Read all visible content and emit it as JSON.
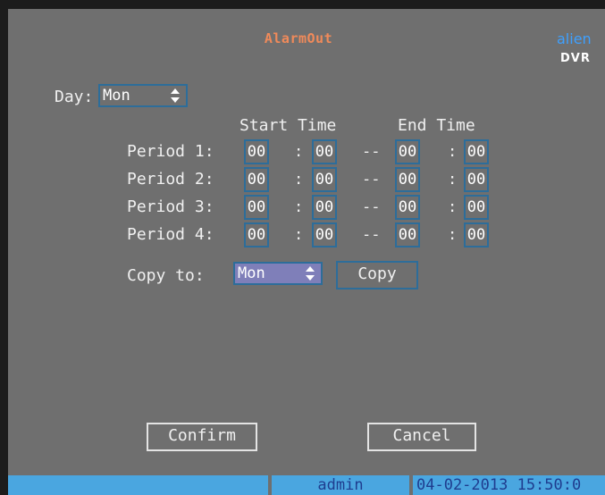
{
  "title": "AlarmOut",
  "logo": {
    "top": "alien",
    "bottom": "DVR"
  },
  "day": {
    "label": "Day:",
    "value": "Mon"
  },
  "headers": {
    "start": "Start Time",
    "end": "End Time"
  },
  "periods": [
    {
      "label": "Period 1:",
      "start_h": "00",
      "start_m": "00",
      "end_h": "00",
      "end_m": "00"
    },
    {
      "label": "Period 2:",
      "start_h": "00",
      "start_m": "00",
      "end_h": "00",
      "end_m": "00"
    },
    {
      "label": "Period 3:",
      "start_h": "00",
      "start_m": "00",
      "end_h": "00",
      "end_m": "00"
    },
    {
      "label": "Period 4:",
      "start_h": "00",
      "start_m": "00",
      "end_h": "00",
      "end_m": "00"
    }
  ],
  "separators": {
    "colon": ":",
    "dash": "--"
  },
  "copy": {
    "label": "Copy to:",
    "value": "Mon",
    "button": "Copy"
  },
  "buttons": {
    "confirm": "Confirm",
    "cancel": "Cancel"
  },
  "status": {
    "user": "admin",
    "datetime": "04-02-2013 15:50:0"
  },
  "colors": {
    "background": "#6f6f6f",
    "field_border": "#2d6d9a",
    "title": "#f08a5a",
    "status_bar": "#4aa6e0"
  }
}
